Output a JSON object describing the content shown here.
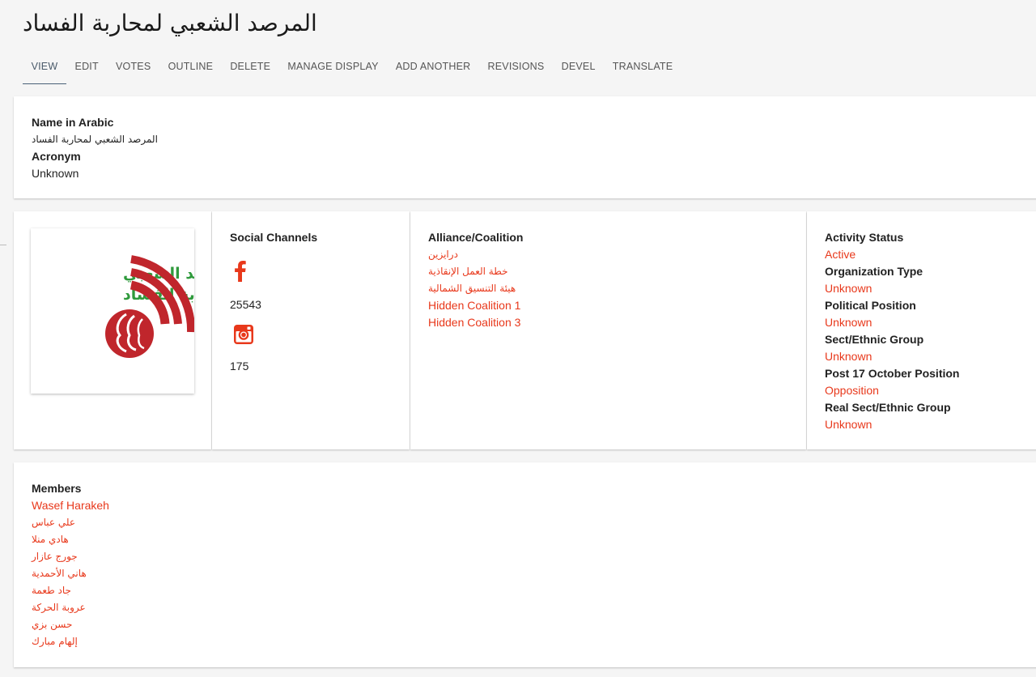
{
  "page": {
    "title": "المرصد الشعبي لمحاربة الفساد"
  },
  "tabs": [
    {
      "label": "VIEW",
      "active": true
    },
    {
      "label": "EDIT"
    },
    {
      "label": "VOTES"
    },
    {
      "label": "OUTLINE"
    },
    {
      "label": "DELETE"
    },
    {
      "label": "MANAGE DISPLAY"
    },
    {
      "label": "ADD ANOTHER"
    },
    {
      "label": "REVISIONS"
    },
    {
      "label": "DEVEL"
    },
    {
      "label": "TRANSLATE"
    }
  ],
  "info": {
    "name_arabic_label": "Name in Arabic",
    "name_arabic_value": "المرصد الشعبي لمحاربة الفساد",
    "acronym_label": "Acronym",
    "acronym_value": "Unknown"
  },
  "logo": {
    "line1": "المرصد الشعبي",
    "line2": "لمحاربة الفساد"
  },
  "social": {
    "label": "Social Channels",
    "facebook_icon": "facebook-icon",
    "facebook_count": "25543",
    "instagram_icon": "instagram-icon",
    "instagram_count": "175"
  },
  "alliance": {
    "label": "Alliance/Coalition",
    "items": [
      "درايزين",
      "خطة العمل الإنقاذية",
      "هيئة التنسيق الشمالية",
      "Hidden Coalition 1",
      "Hidden Coalition 3"
    ]
  },
  "status": {
    "activity_label": "Activity Status",
    "activity_value": "Active",
    "org_type_label": "Organization Type",
    "org_type_value": "Unknown",
    "political_label": "Political Position",
    "political_value": "Unknown",
    "sect_label": "Sect/Ethnic Group",
    "sect_value": "Unknown",
    "post17_label": "Post 17 October Position",
    "post17_value": "Opposition",
    "real_sect_label": "Real Sect/Ethnic Group",
    "real_sect_value": "Unknown"
  },
  "members": {
    "label": "Members",
    "items": [
      "Wasef Harakeh",
      "علي عباس",
      "هادي منلا",
      "جورج عازار",
      "هاني الأحمدية",
      "جاد طعمة",
      "عروبة الحركة",
      "حسن بزي",
      "إلهام مبارك"
    ]
  },
  "colors": {
    "link": "#e8381b",
    "logo_green": "#2f9a3c",
    "logo_red": "#c0262c"
  }
}
